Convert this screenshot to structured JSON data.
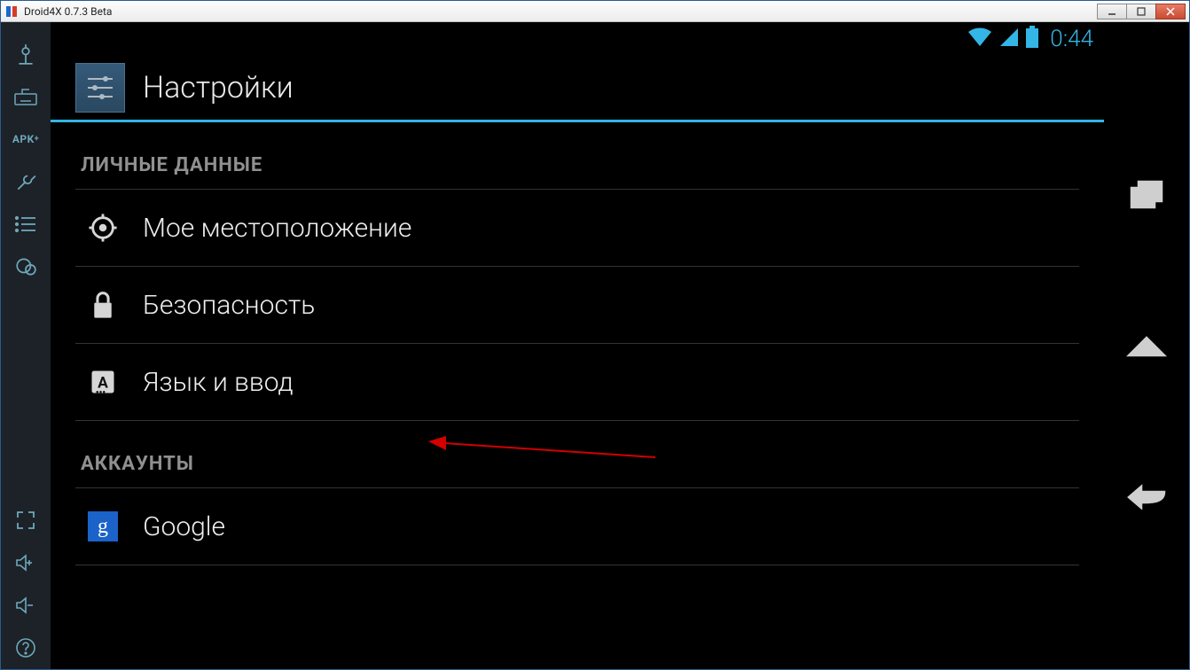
{
  "window": {
    "title": "Droid4X 0.7.3 Beta"
  },
  "sidebar": {
    "apk_label": "APK"
  },
  "status": {
    "time": "0:44"
  },
  "settings": {
    "title": "Настройки",
    "sections": [
      {
        "header": "ЛИЧНЫЕ ДАННЫЕ",
        "items": [
          {
            "icon": "location",
            "label": "Мое местоположение"
          },
          {
            "icon": "lock",
            "label": "Безопасность"
          },
          {
            "icon": "language",
            "label": "Язык и ввод"
          }
        ]
      },
      {
        "header": "АККАУНТЫ",
        "items": [
          {
            "icon": "google",
            "label": "Google",
            "google_glyph": "g"
          }
        ]
      }
    ]
  }
}
